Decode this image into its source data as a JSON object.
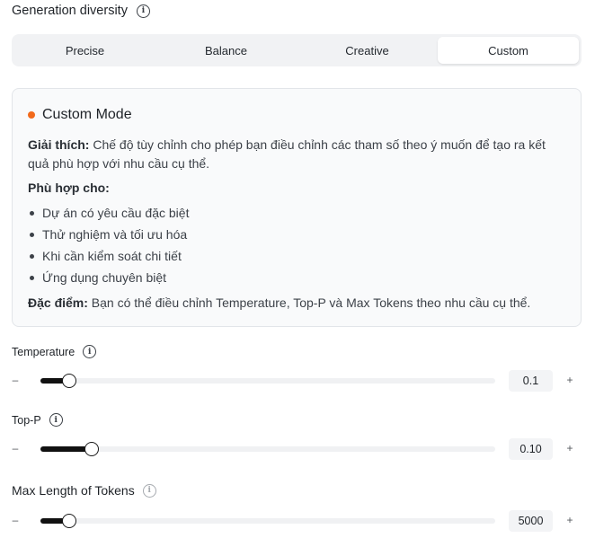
{
  "header": {
    "title": "Generation diversity",
    "info_icon": "info-icon"
  },
  "modes": [
    {
      "label": "Precise",
      "active": false
    },
    {
      "label": "Balance",
      "active": false
    },
    {
      "label": "Creative",
      "active": false
    },
    {
      "label": "Custom",
      "active": true
    }
  ],
  "card": {
    "dot_color": "#f26a1b",
    "title": "Custom Mode",
    "explain_label": "Giải thích:",
    "explain_text": " Chế độ tùy chỉnh cho phép bạn điều chỉnh các tham số theo ý muốn để tạo ra kết quả phù hợp với nhu cầu cụ thể.",
    "suitable_label": "Phù hợp cho:",
    "bullets": [
      "Dự án có yêu cầu đặc biệt",
      "Thử nghiệm và tối ưu hóa",
      "Khi cần kiểm soát chi tiết",
      "Ứng dụng chuyên biệt"
    ],
    "feature_label": "Đặc điểm:",
    "feature_text": " Bạn có thể điều chỉnh Temperature, Top-P và Max Tokens theo nhu cầu cụ thể."
  },
  "params": {
    "temperature": {
      "label": "Temperature",
      "value": "0.1",
      "level": 0.063,
      "minus": "–",
      "plus": "+"
    },
    "top_p": {
      "label": "Top-P",
      "value": "0.10",
      "level": 0.112,
      "minus": "–",
      "plus": "+"
    },
    "max_tokens": {
      "label": "Max Length of Tokens",
      "value": "5000",
      "level": 0.063,
      "minus": "–",
      "plus": "+"
    }
  },
  "colors": {
    "accent_dot": "#f26a1b",
    "slider_fill": "#111111"
  }
}
